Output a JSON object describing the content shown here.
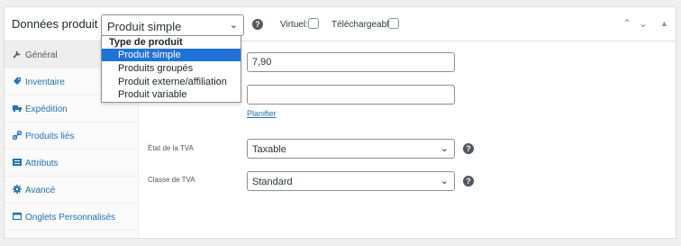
{
  "header": {
    "title": "Données produit —",
    "product_type_value": "Produit simple",
    "virtual_label": "Virtuel:",
    "downloadable_label": "Téléchargeable:",
    "help_glyph": "?"
  },
  "dropdown": {
    "group_label": "Type de produit",
    "options": [
      {
        "label": "Produit simple",
        "selected": true
      },
      {
        "label": "Produits groupés",
        "selected": false
      },
      {
        "label": "Produit externe/affiliation",
        "selected": false
      },
      {
        "label": "Produit variable",
        "selected": false
      }
    ]
  },
  "sidebar": {
    "items": [
      {
        "label": "Général",
        "icon": "wrench-icon",
        "active": true
      },
      {
        "label": "Inventaire",
        "icon": "tag-icon",
        "active": false
      },
      {
        "label": "Expédition",
        "icon": "truck-icon",
        "active": false
      },
      {
        "label": "Produits liés",
        "icon": "link-icon",
        "active": false
      },
      {
        "label": "Attributs",
        "icon": "list-icon",
        "active": false
      },
      {
        "label": "Avancé",
        "icon": "gear-icon",
        "active": false
      },
      {
        "label": "Onglets Personnalisés",
        "icon": "tabs-icon",
        "active": false
      }
    ]
  },
  "general": {
    "regular_price_value": "7,90",
    "sale_price_value": "",
    "schedule_link": "Planifier",
    "tax_status_label": "État de la TVA",
    "tax_status_value": "Taxable",
    "tax_class_label": "Classe de TVA",
    "tax_class_value": "Standard"
  },
  "colors": {
    "accent": "#2271b1",
    "selected_option": "#1e73d8"
  }
}
